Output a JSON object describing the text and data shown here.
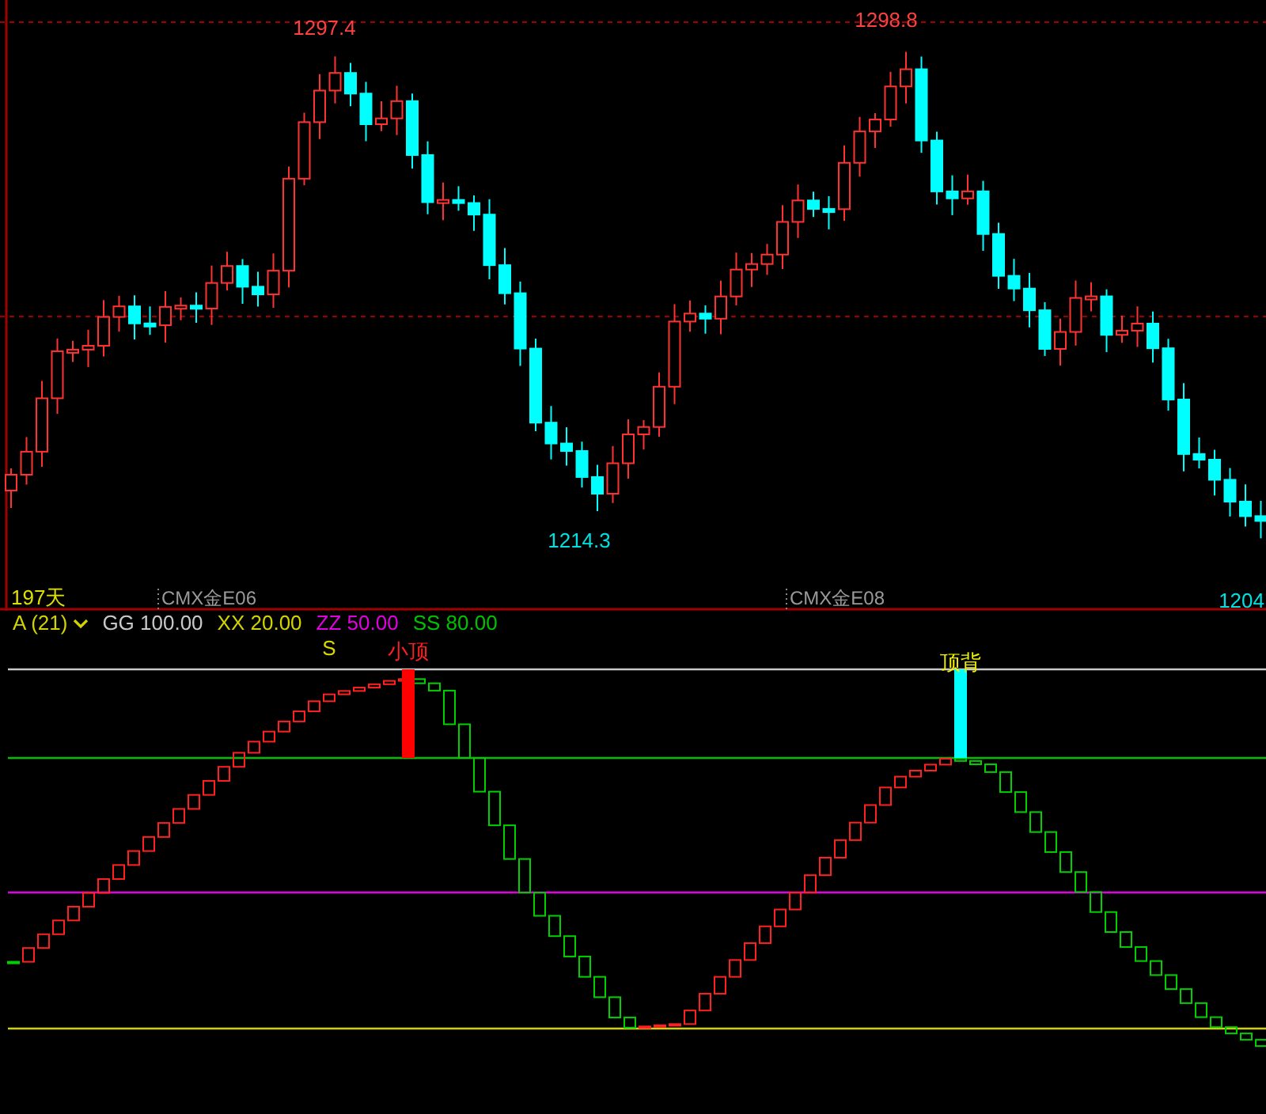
{
  "price_panel": {
    "high_labels": [
      "1297.4",
      "1298.8"
    ],
    "low_labels": [
      "1214.3",
      "1204"
    ],
    "period_label": "197天",
    "contract_labels": [
      "CMX金E06",
      "CMX金E08"
    ]
  },
  "indicator_panel": {
    "name": "A (21)",
    "params": [
      {
        "text": "GG 100.00",
        "color": "#c8c8c8"
      },
      {
        "text": "XX 20.00",
        "color": "#d2d200"
      },
      {
        "text": "ZZ 50.00",
        "color": "#e000e0"
      },
      {
        "text": "SS 80.00",
        "color": "#00c000"
      }
    ],
    "signal_bars": [
      {
        "color": "#ff0000"
      },
      {
        "color": "#00ffff"
      }
    ],
    "signal_labels": [
      {
        "text": "S",
        "color": "#d8d800"
      },
      {
        "text": "小顶",
        "color": "#ff2020"
      },
      {
        "text": "顶背",
        "color": "#f0f000"
      }
    ]
  }
}
